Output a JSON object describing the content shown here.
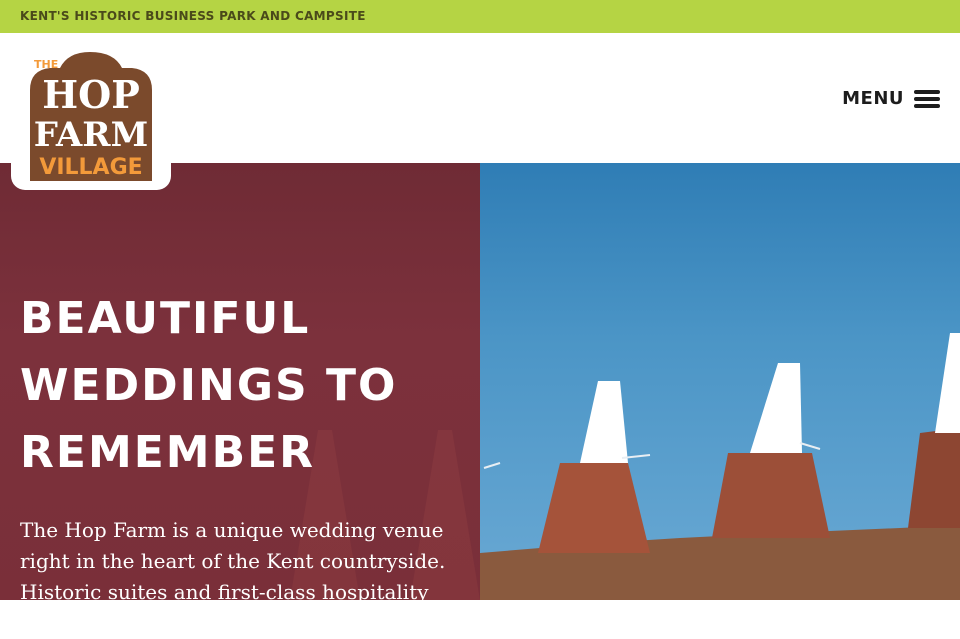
{
  "topbar": {
    "tagline": "Kent's historic business park and campsite"
  },
  "logo": {
    "line1": "THE",
    "line2": "HOP",
    "line3": "FARM",
    "line4": "VILLAGE"
  },
  "nav": {
    "menu_label": "MENU"
  },
  "hero": {
    "heading_line1": "Beautiful",
    "heading_line2": "weddings to",
    "heading_line3": "remember",
    "intro": "The Hop Farm is a unique wedding venue right in the heart of the Kent countryside. Historic suites and first-class hospitality for"
  },
  "colors": {
    "topbar": "#b5d444",
    "hero_panel": "#7a2f39",
    "logo_brown": "#7b4a2c",
    "logo_orange": "#f39a3a"
  }
}
